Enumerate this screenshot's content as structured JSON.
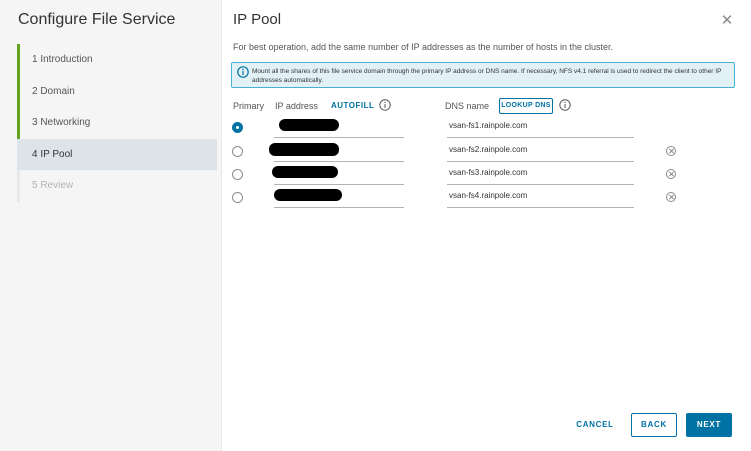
{
  "wizard": {
    "title": "Configure File Service",
    "steps": [
      {
        "label": "1  Introduction",
        "state": "done"
      },
      {
        "label": "2  Domain",
        "state": "done"
      },
      {
        "label": "3  Networking",
        "state": "done"
      },
      {
        "label": "4  IP Pool",
        "state": "active"
      },
      {
        "label": "5  Review",
        "state": "disabled"
      }
    ]
  },
  "page": {
    "title": "IP Pool",
    "subtitle": "For best operation, add the same number of IP addresses as the number of hosts in the cluster.",
    "info": "Mount all the shares of this file service domain through the primary IP address or DNS name. If necessary, NFS v4.1 referral is used to redirect the client to other IP addresses automatically."
  },
  "columns": {
    "primary": "Primary",
    "ip_address": "IP address",
    "autofill": "AUTOFILL",
    "dns_name": "DNS name",
    "lookup_dns": "LOOKUP DNS"
  },
  "rows": [
    {
      "dns": "vsan-fs1.rainpole.com",
      "primary": true
    },
    {
      "dns": "vsan-fs2.rainpole.com",
      "primary": false
    },
    {
      "dns": "vsan-fs3.rainpole.com",
      "primary": false
    },
    {
      "dns": "vsan-fs4.rainpole.com",
      "primary": false
    }
  ],
  "footer": {
    "cancel": "CANCEL",
    "back": "BACK",
    "next": "NEXT"
  },
  "colors": {
    "accent": "#0072a3",
    "done_step": "#62a420",
    "info_bg": "#e1f1f6"
  }
}
